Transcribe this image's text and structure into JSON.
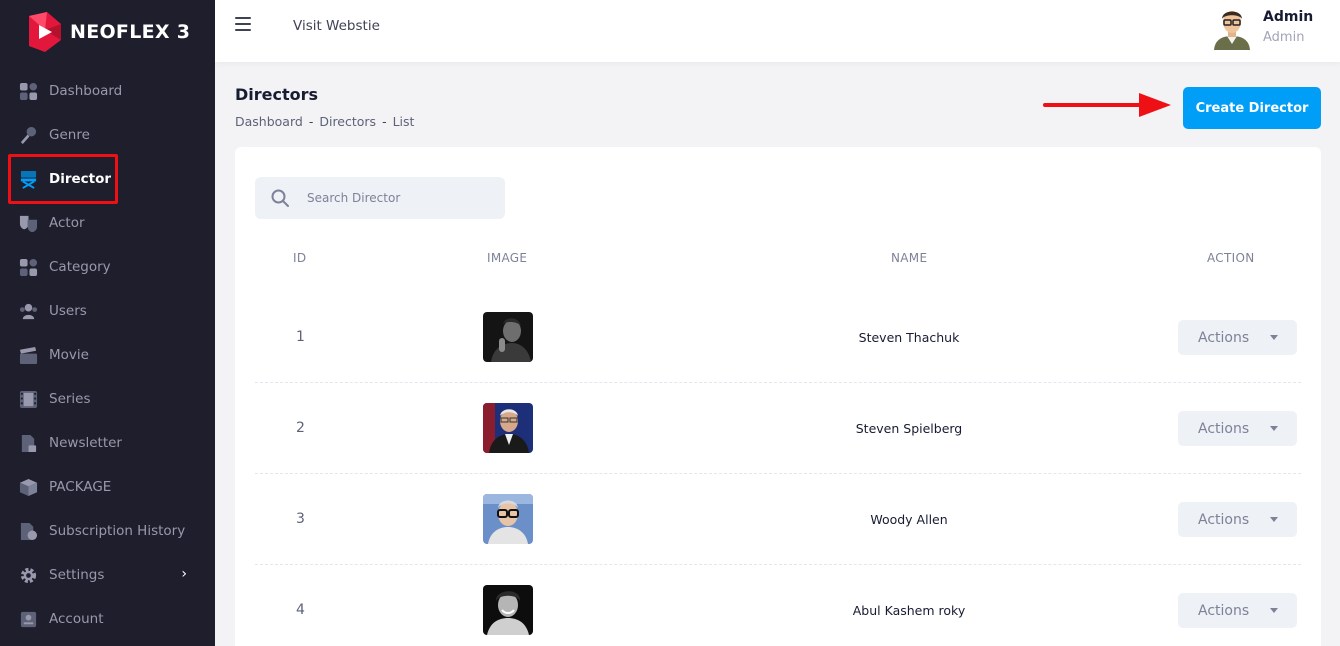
{
  "brand": {
    "name": "NEOFLEX 3"
  },
  "sidebar": {
    "items": [
      {
        "label": "Dashboard",
        "icon": "grid-icon"
      },
      {
        "label": "Genre",
        "icon": "microphone-icon"
      },
      {
        "label": "Director",
        "icon": "director-chair-icon",
        "active": true
      },
      {
        "label": "Actor",
        "icon": "theater-masks-icon"
      },
      {
        "label": "Category",
        "icon": "grid-icon"
      },
      {
        "label": "Users",
        "icon": "users-icon"
      },
      {
        "label": "Movie",
        "icon": "clapperboard-icon"
      },
      {
        "label": "Series",
        "icon": "film-strip-icon"
      },
      {
        "label": "Newsletter",
        "icon": "newsletter-icon"
      },
      {
        "label": "PACKAGE",
        "icon": "box-icon"
      },
      {
        "label": "Subscription History",
        "icon": "file-history-icon"
      },
      {
        "label": "Settings",
        "icon": "gear-icon"
      },
      {
        "label": "Account",
        "icon": "id-card-icon"
      }
    ],
    "accent_color": "#009ef7",
    "highlight_color": "#ef1016"
  },
  "header": {
    "visit_link": "Visit Webstie",
    "user": {
      "name": "Admin",
      "role": "Admin"
    }
  },
  "toolbar": {
    "title": "Directors",
    "breadcrumb": [
      "Dashboard",
      "Directors",
      "List"
    ],
    "breadcrumb_sep": "-",
    "create_label": "Create Director"
  },
  "search": {
    "placeholder": "Search Director"
  },
  "table": {
    "columns": [
      "ID",
      "IMAGE",
      "NAME",
      "ACTION"
    ],
    "rows": [
      {
        "id": "1",
        "name": "Steven Thachuk",
        "action": "Actions"
      },
      {
        "id": "2",
        "name": "Steven Spielberg",
        "action": "Actions"
      },
      {
        "id": "3",
        "name": "Woody Allen",
        "action": "Actions"
      },
      {
        "id": "4",
        "name": "Abul Kashem roky",
        "action": "Actions"
      }
    ]
  }
}
